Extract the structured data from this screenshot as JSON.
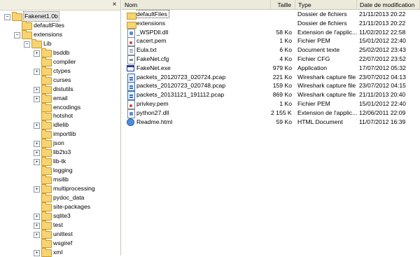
{
  "tree": {
    "items": [
      {
        "label": "Fakenet1.0b",
        "expander": "-",
        "selected": true
      },
      {
        "label": "defaultFiles",
        "expander": ""
      },
      {
        "label": "extensions",
        "expander": "-"
      },
      {
        "label": "Lib",
        "expander": "-"
      },
      {
        "label": "bsddb",
        "expander": "+"
      },
      {
        "label": "compiler",
        "expander": ""
      },
      {
        "label": "ctypes",
        "expander": "+"
      },
      {
        "label": "curses",
        "expander": ""
      },
      {
        "label": "distutils",
        "expander": "+"
      },
      {
        "label": "email",
        "expander": "+"
      },
      {
        "label": "encodings",
        "expander": ""
      },
      {
        "label": "hotshot",
        "expander": ""
      },
      {
        "label": "idlelib",
        "expander": "+"
      },
      {
        "label": "importlib",
        "expander": ""
      },
      {
        "label": "json",
        "expander": "+"
      },
      {
        "label": "lib2to3",
        "expander": "+"
      },
      {
        "label": "lib-tk",
        "expander": "+"
      },
      {
        "label": "logging",
        "expander": ""
      },
      {
        "label": "msilib",
        "expander": ""
      },
      {
        "label": "multiprocessing",
        "expander": "+"
      },
      {
        "label": "pydoc_data",
        "expander": ""
      },
      {
        "label": "site-packages",
        "expander": ""
      },
      {
        "label": "sqlite3",
        "expander": "+"
      },
      {
        "label": "test",
        "expander": "+"
      },
      {
        "label": "unittest",
        "expander": "+"
      },
      {
        "label": "wsgiref",
        "expander": ""
      },
      {
        "label": "xml",
        "expander": "+"
      }
    ]
  },
  "close_label": "×",
  "columns": {
    "name": "Nom",
    "size": "Taille",
    "type": "Type",
    "date": "Date de modification"
  },
  "files": [
    {
      "name": "defaultFiles",
      "size": "",
      "type": "Dossier de fichiers",
      "date": "21/11/2013 20:22",
      "icon": "folder-icon"
    },
    {
      "name": "extensions",
      "size": "",
      "type": "Dossier de fichiers",
      "date": "21/11/2013 20:22",
      "icon": "folder-icon"
    },
    {
      "name": "_WSPDll.dll",
      "size": "58 Ko",
      "type": "Extension de l'applic...",
      "date": "11/02/2012 22:58",
      "icon": "dll-icon"
    },
    {
      "name": "cacert.pem",
      "size": "1 Ko",
      "type": "Fichier PEM",
      "date": "15/01/2012 22:40",
      "icon": "certificate-icon"
    },
    {
      "name": "Eula.txt",
      "size": "6 Ko",
      "type": "Document texte",
      "date": "25/02/2012 23:43",
      "icon": "text-file-icon"
    },
    {
      "name": "FakeNet.cfg",
      "size": "4 Ko",
      "type": "Fichier CFG",
      "date": "22/07/2012 23:52",
      "icon": "config-file-icon"
    },
    {
      "name": "FakeNet.exe",
      "size": "979 Ko",
      "type": "Application",
      "date": "17/07/2012 05:32",
      "icon": "application-icon"
    },
    {
      "name": "packets_20120723_020724.pcap",
      "size": "221 Ko",
      "type": "Wireshark capture file",
      "date": "23/07/2012 04:13",
      "icon": "pcap-icon"
    },
    {
      "name": "packets_20120723_020748.pcap",
      "size": "159 Ko",
      "type": "Wireshark capture file",
      "date": "23/07/2012 04:15",
      "icon": "pcap-icon"
    },
    {
      "name": "packets_20131121_191112.pcap",
      "size": "869 Ko",
      "type": "Wireshark capture file",
      "date": "21/11/2013 20:40",
      "icon": "pcap-icon"
    },
    {
      "name": "privkey.pem",
      "size": "1 Ko",
      "type": "Fichier PEM",
      "date": "15/01/2012 22:40",
      "icon": "certificate-icon"
    },
    {
      "name": "python27.dll",
      "size": "2 155 Ko",
      "type": "Extension de l'applic...",
      "date": "12/06/2011 22:09",
      "icon": "dll-icon"
    },
    {
      "name": "Readme.html",
      "size": "59 Ko",
      "type": "HTML Document",
      "date": "11/07/2012 16:39",
      "icon": "html-file-icon"
    }
  ]
}
